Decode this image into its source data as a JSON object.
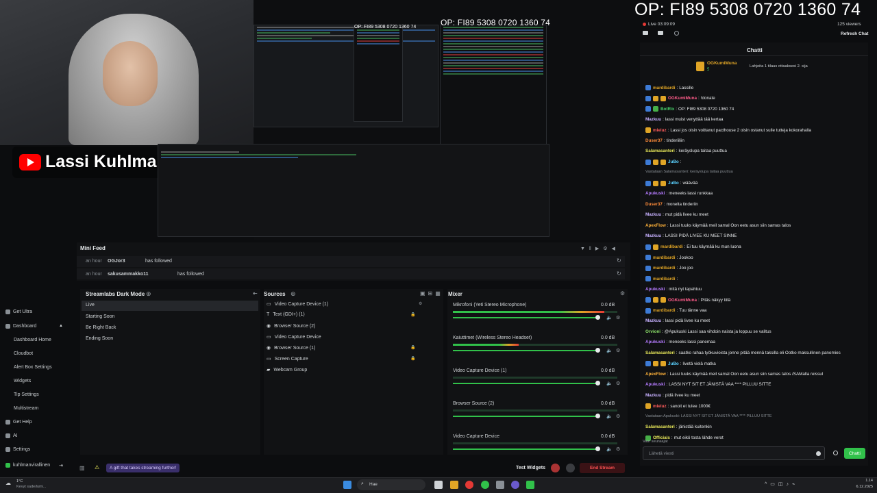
{
  "webcam": {
    "channel_name": "Lassi Kuhlman"
  },
  "overlay": {
    "op_banner": "OP: FI89 5308 0720 1360 74",
    "op_preview_mid": "OP: FI89 5308 0720 1360 74",
    "op_preview_small": "OP: FI89 5308 0720 1360 74"
  },
  "stream_header": {
    "live_label": "Live 03:09:09",
    "viewers": "125 viewers",
    "refresh_chat": "Refresh Chat",
    "chat_tab": "Chatti"
  },
  "pinned": {
    "user": "OGKumiMuna",
    "count": "5",
    "text": "Lahjoita 1 tilaus ottaaksesi 2. sija"
  },
  "chat_messages": [
    {
      "user": "mardibardi",
      "text": "Lassille",
      "color": "#e0a526",
      "badges": [
        "b"
      ]
    },
    {
      "user": "OGKumiMuna",
      "text": "!donate",
      "color": "#ff5c8a",
      "badges": [
        "b",
        "y",
        "y"
      ]
    },
    {
      "user": "BotRix",
      "text": "OP: FI89 5308 0720 1360 74",
      "color": "#47d16a",
      "badges": [
        "b",
        "g"
      ]
    },
    {
      "user": "Mazkuu",
      "text": "lassi muist venyttää tää kertaa",
      "color": "#c7b1ff",
      "badges": []
    },
    {
      "user": "mieluz",
      "text": "Lassi jos oisin voittanut pacthouse 2 oisin ostanut sulle tutteja kokorahalla",
      "color": "#ff5c5c",
      "badges": [
        "y"
      ]
    },
    {
      "user": "Duser37",
      "text": "tinderiiliin",
      "color": "#ff8c3a",
      "badges": []
    },
    {
      "user": "Salamasanteri",
      "text": "keräyslupa taitaa puuttua",
      "color": "#e8e85a",
      "badges": []
    },
    {
      "user": "JuBo",
      "text": "",
      "color": "#5ad1ff",
      "badges": [
        "b",
        "y",
        "y"
      ]
    },
    {
      "user": "",
      "text": "Vastataan Salamasanteri: keräyslupa taitaa puuttua",
      "color": "#8a9096",
      "badges": []
    },
    {
      "user": "JuBo",
      "text": "wäävää",
      "color": "#5ad1ff",
      "badges": [
        "b",
        "y",
        "y"
      ]
    },
    {
      "user": "Apukuski",
      "text": "meneeks lassi runkkaa",
      "color": "#b57bff",
      "badges": []
    },
    {
      "user": "Duser37",
      "text": "monelta tinderiin",
      "color": "#ff8c3a",
      "badges": []
    },
    {
      "user": "Mazkuu",
      "text": "mut pidä livee ku meet",
      "color": "#c7b1ff",
      "badges": []
    },
    {
      "user": "ApexFlow",
      "text": "Lassi tuuks käymää meil samal Oon eetu asun siin samas talos",
      "color": "#ffb23a",
      "badges": []
    },
    {
      "user": "Mazkuu",
      "text": "LASSI PIDÄ LIVEE KU MEET SINNE",
      "color": "#c7b1ff",
      "badges": []
    },
    {
      "user": "mardibardi",
      "text": "Ei tuu käymää ku mun luona",
      "color": "#e0a526",
      "badges": [
        "b",
        "y"
      ]
    },
    {
      "user": "mardibardi",
      "text": "Jookoo",
      "color": "#e0a526",
      "badges": [
        "b"
      ]
    },
    {
      "user": "mardibardi",
      "text": "Joo joo",
      "color": "#e0a526",
      "badges": [
        "b"
      ]
    },
    {
      "user": "mardibardi",
      "text": "",
      "color": "#e0a526",
      "badges": [
        "b"
      ]
    },
    {
      "user": "Apukuski",
      "text": "mitä nyt tapahtuu",
      "color": "#b57bff",
      "badges": []
    },
    {
      "user": "OGKumiMuna",
      "text": "Pitäs näkyy tiilä",
      "color": "#ff5c8a",
      "badges": [
        "b",
        "y",
        "y"
      ]
    },
    {
      "user": "mardibardi",
      "text": "Tuu tänne vaa",
      "color": "#e0a526",
      "badges": [
        "b"
      ]
    },
    {
      "user": "Mazkuu",
      "text": "lassi pidä livee ku meet",
      "color": "#c7b1ff",
      "badges": []
    },
    {
      "user": "Orvioni",
      "text": "@Apukuski Lassi saa vihdoin naista ja loppuu se valitus",
      "color": "#8ce06a",
      "badges": []
    },
    {
      "user": "Apukuski",
      "text": "meneeks lassi panemaa",
      "color": "#b57bff",
      "badges": []
    },
    {
      "user": "Salamasanteri",
      "text": "saatko rahaa työkuvioista jonne pitää mennä taksilla eli Ootko maksullinen panomies",
      "color": "#e8e85a",
      "badges": []
    },
    {
      "user": "JuBo",
      "text": "livetä vielä matka",
      "color": "#5ad1ff",
      "badges": [
        "b",
        "y",
        "y"
      ]
    },
    {
      "user": "ApexFlow",
      "text": "Lassi tuuks käymää meil samal Oon eetu asun siin samas talos /SAMalla reissul",
      "color": "#ffb23a",
      "badges": []
    },
    {
      "user": "Apukuski",
      "text": "LASSI NYT SIT ET JÄNISTÄ VAA **** PILLUU SITTE",
      "color": "#b57bff",
      "badges": []
    },
    {
      "user": "Mazkuu",
      "text": "pidä livee ku meet",
      "color": "#c7b1ff",
      "badges": []
    },
    {
      "user": "mieluz",
      "text": "sanoit et tulee 1000€",
      "color": "#ff5c5c",
      "badges": [
        "y"
      ]
    },
    {
      "user": "",
      "text": "Vastataan Apukuski: LASSI NYT SIT ET JÄNISTÄ VAA **** PILLUU SITTE",
      "color": "#8a9096",
      "badges": []
    },
    {
      "user": "Salamasanteri",
      "text": "jänistää kuitenkin",
      "color": "#e8e85a",
      "badges": []
    },
    {
      "user": "Officials",
      "text": "mut eikö tosta lähde verot",
      "color": "#e8e85a",
      "badges": [
        "g"
      ]
    }
  ],
  "chat_footer": {
    "followers_only": "Vain seuraajat",
    "input_placeholder": "Lähetä viesti",
    "send_button": "Chatti"
  },
  "sidebar": {
    "items": [
      "Get Ultra",
      "Dashboard",
      "Dashboard Home",
      "Cloudbot",
      "Alert Box Settings",
      "Widgets",
      "Tip Settings",
      "Multistream",
      "Get Help",
      "AI",
      "Settings"
    ],
    "user": "kuhlmanvirallinen"
  },
  "mini_feed": {
    "title": "Mini Feed",
    "events": [
      {
        "time": "an hour",
        "user": "OGJor3",
        "action": "has followed"
      },
      {
        "time": "an hour",
        "user": "sakusammakko11",
        "action": "has followed"
      }
    ]
  },
  "scenes": {
    "title": "Streamlabs Dark Mode",
    "items": [
      "Live",
      "Starting Soon",
      "Be Right Back",
      "Ending Soon"
    ]
  },
  "sources": {
    "title": "Sources",
    "items": [
      "Video Capture Device (1)",
      "Text (GDI+) (1)",
      "Browser Source (2)",
      "Video Capture Device",
      "Browser Source (1)",
      "Screen Capture",
      "Webcam Group"
    ]
  },
  "mixer": {
    "title": "Mixer",
    "channels": [
      {
        "name": "Mikrofoni (Yeti Stereo Microphone)",
        "db": "0.0 dB",
        "level": 0.92
      },
      {
        "name": "Kaiuttimet (Wireless Stereo Headset)",
        "db": "0.0 dB",
        "level": 0.4
      },
      {
        "name": "Video Capture Device (1)",
        "db": "0.0 dB",
        "level": 0.0
      },
      {
        "name": "Browser Source (2)",
        "db": "0.0 dB",
        "level": 0.0
      },
      {
        "name": "Video Capture Device",
        "db": "0.0 dB",
        "level": 0.0
      }
    ]
  },
  "bottom_bar": {
    "promo": "A gift that takes streaming further!",
    "test_widgets": "Test Widgets",
    "end_stream": "End Stream"
  },
  "taskbar": {
    "weather_temp": "1°C",
    "weather_desc": "Kevyt sade/lumi...",
    "search": "Hae",
    "time": "1.14",
    "date": "6.12.2025"
  }
}
